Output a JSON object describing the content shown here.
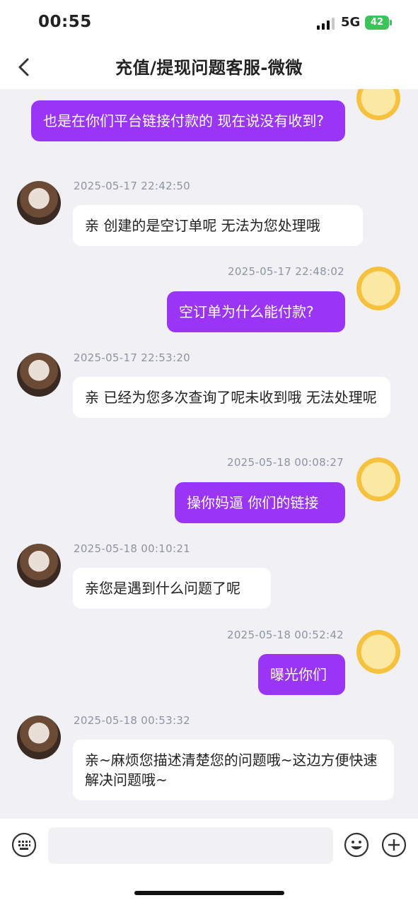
{
  "status": {
    "time": "00:55",
    "network": "5G",
    "battery": "42"
  },
  "nav": {
    "title": "充值/提现问题客服-微微",
    "back_icon": "chevron-left-icon"
  },
  "messages": [
    {
      "side": "right",
      "timestamp": "",
      "text": "也是在你们平台链接付款的 现在说没有收到?"
    },
    {
      "side": "left",
      "timestamp": "2025-05-17 22:42:50",
      "text": "亲 创建的是空订单呢 无法为您处理哦"
    },
    {
      "side": "right",
      "timestamp": "2025-05-17 22:48:02",
      "text": "空订单为什么能付款?"
    },
    {
      "side": "left",
      "timestamp": "2025-05-17 22:53:20",
      "text": "亲 已经为您多次查询了呢未收到哦 无法处理呢"
    },
    {
      "side": "right",
      "timestamp": "2025-05-18 00:08:27",
      "text": "操你妈逼 你们的链接"
    },
    {
      "side": "left",
      "timestamp": "2025-05-18 00:10:21",
      "text": "亲您是遇到什么问题了呢"
    },
    {
      "side": "right",
      "timestamp": "2025-05-18 00:52:42",
      "text": "曝光你们"
    },
    {
      "side": "left",
      "timestamp": "2025-05-18 00:53:32",
      "text": "亲~麻烦您描述清楚您的问题哦~这边方便快速解决问题哦~"
    }
  ],
  "input": {
    "value": "",
    "placeholder": ""
  },
  "colors": {
    "user_bubble": "#9b35f5",
    "agent_bubble": "#ffffff",
    "background": "#f1f1f5"
  }
}
